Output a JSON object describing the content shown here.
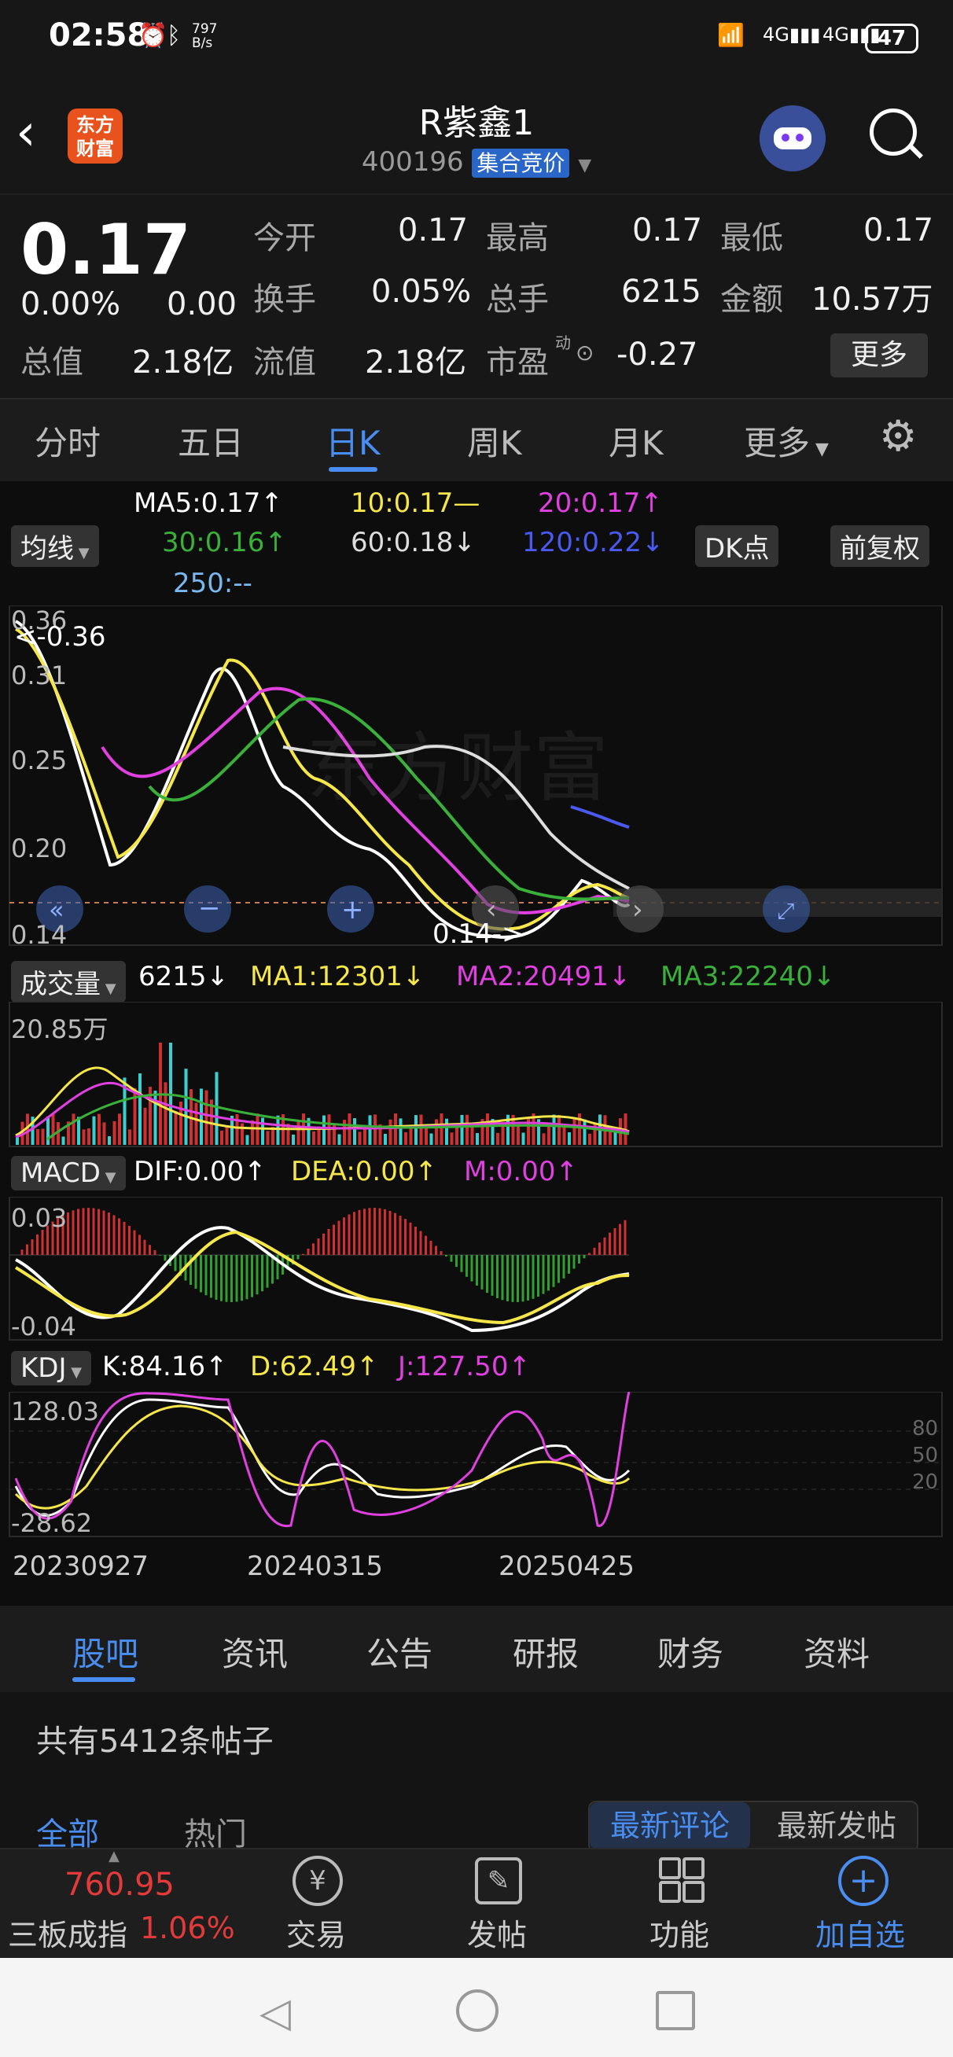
{
  "status": {
    "time": "02:58",
    "speed_value": "797",
    "speed_unit": "B/s",
    "battery": "47"
  },
  "header": {
    "logo": "东方财富",
    "stock_name": "R紫鑫1",
    "stock_code": "400196",
    "auction_tag": "集合竞价"
  },
  "quote": {
    "price": "0.17",
    "change_pct": "0.00%",
    "change": "0.00",
    "open_label": "今开",
    "open": "0.17",
    "high_label": "最高",
    "high": "0.17",
    "low_label": "最低",
    "low": "0.17",
    "turnover_label": "换手",
    "turnover": "0.05%",
    "volume_label": "总手",
    "volume": "6215",
    "amount_label": "金额",
    "amount": "10.57万",
    "mktcap_label": "总值",
    "mktcap": "2.18亿",
    "float_label": "流值",
    "float": "2.18亿",
    "pe_label": "市盈",
    "pe_sup": "动",
    "pe": "-0.27",
    "more": "更多"
  },
  "tabs": [
    "分时",
    "五日",
    "日K",
    "周K",
    "月K",
    "更多"
  ],
  "ma": {
    "selector": "均线",
    "ma5": "MA5:0.17↑",
    "ma10": "10:0.17—",
    "ma20": "20:0.17↑",
    "ma30": "30:0.16↑",
    "ma60": "60:0.18↓",
    "ma120": "120:0.22↓",
    "ma250": "250:--",
    "dk": "DK点",
    "adjust": "前复权"
  },
  "kline_axis": {
    "y1": "0.36",
    "y2": "0.31",
    "y3": "0.25",
    "y4": "0.20",
    "y5": "0.14",
    "hi_marker": "<-0.36",
    "lo_marker": "0.14->"
  },
  "volume": {
    "selector": "成交量",
    "value": "6215↓",
    "ma1": "MA1:12301↓",
    "ma2": "MA2:20491↓",
    "ma3": "MA3:22240↓",
    "ymax": "20.85万"
  },
  "macd": {
    "selector": "MACD",
    "dif": "DIF:0.00↑",
    "dea": "DEA:0.00↑",
    "m": "M:0.00↑",
    "ymax": "0.03",
    "ymin": "-0.04"
  },
  "kdj": {
    "selector": "KDJ",
    "k": "K:84.16↑",
    "d": "D:62.49↑",
    "j": "J:127.50↑",
    "ymax": "128.03",
    "ymin": "-28.62",
    "l80": "80",
    "l50": "50",
    "l20": "20"
  },
  "dates": [
    "20230927",
    "20240315",
    "20250425"
  ],
  "watermark": "东方财富",
  "bottom_tabs": [
    "股吧",
    "资讯",
    "公告",
    "研报",
    "财务",
    "资料"
  ],
  "posts": {
    "count": "共有5412条帖子",
    "filter_all": "全部",
    "filter_hot": "热门",
    "sort_latest_comment": "最新评论",
    "sort_latest_post": "最新发帖"
  },
  "navbar": {
    "index_value": "760.95",
    "index_name": "三板成指",
    "index_change": "1.06%",
    "trade": "交易",
    "post": "发帖",
    "func": "功能",
    "add": "加自选"
  },
  "colors": {
    "accent": "#4a8df0",
    "up": "#e03a3a",
    "ma5": "#ffffff",
    "ma10": "#f5e74a",
    "ma20": "#e040e0",
    "ma30": "#3ab03a",
    "ma120": "#4a5af0",
    "ma250": "#7ab8f0"
  }
}
